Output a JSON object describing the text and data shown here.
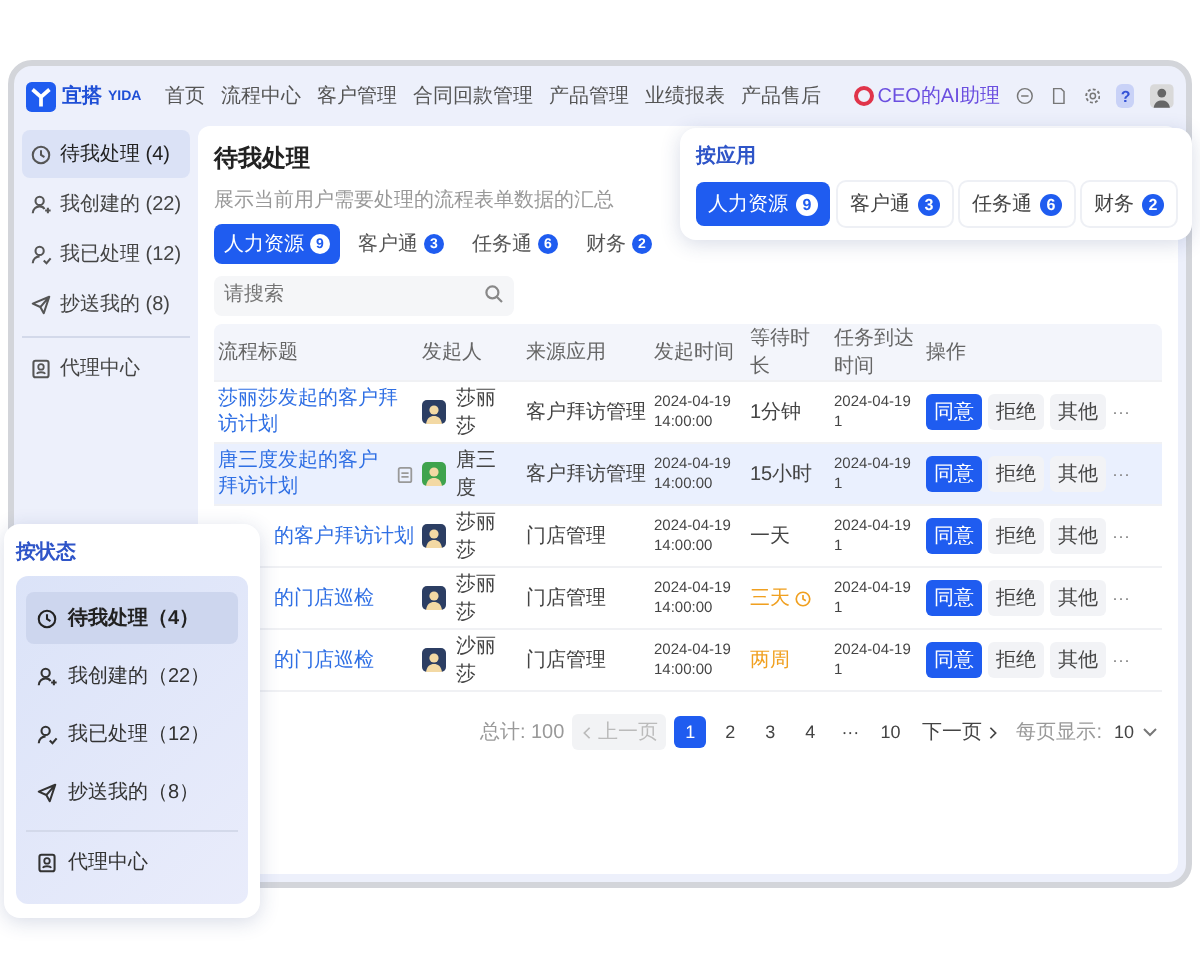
{
  "nav": {
    "logo": {
      "name": "宜搭",
      "latin": "YIDA"
    },
    "items": [
      {
        "label": "首页"
      },
      {
        "label": "流程中心"
      },
      {
        "label": "客户管理"
      },
      {
        "label": "合同回款管理"
      },
      {
        "label": "产品管理"
      },
      {
        "label": "业绩报表"
      },
      {
        "label": "产品售后"
      }
    ],
    "assistant": "CEO的AI助理",
    "help": "?"
  },
  "sidebar": {
    "items": [
      {
        "kind": "clock",
        "label": "待我处理 (4)",
        "selected": true,
        "divider_before": false
      },
      {
        "kind": "person-plus",
        "label": "我创建的 (22)",
        "selected": false,
        "divider_before": false
      },
      {
        "kind": "person-check",
        "label": "我已处理 (12)",
        "selected": false,
        "divider_before": false
      },
      {
        "kind": "send",
        "label": "抄送我的 (8)",
        "selected": false,
        "divider_before": false
      },
      {
        "kind": "agent",
        "label": "代理中心",
        "selected": false,
        "divider_before": true
      }
    ]
  },
  "page": {
    "title": "待我处理",
    "description": "展示当前用户需要处理的流程表单数据的汇总"
  },
  "app_tabs": [
    {
      "label": "人力资源",
      "count": "9",
      "selected": true
    },
    {
      "label": "客户通",
      "count": "3",
      "selected": false
    },
    {
      "label": "任务通",
      "count": "6",
      "selected": false
    },
    {
      "label": "财务",
      "count": "2",
      "selected": false
    }
  ],
  "search": {
    "placeholder": "请搜索"
  },
  "table": {
    "columns": [
      "流程标题",
      "发起人",
      "来源应用",
      "发起时间",
      "等待时长",
      "任务到达时间",
      "操作"
    ],
    "rows": [
      {
        "selected": false,
        "covered": false,
        "title": "莎丽莎发起的客户拜访计划",
        "attachment": false,
        "initiator": {
          "name": "莎丽莎",
          "color": "#2c3e63"
        },
        "app": "客户拜访管理",
        "started": "2024-04-19 14:00:00",
        "wait": {
          "text": "1分钟",
          "overdue": false,
          "clock": false
        },
        "arrival": "2024-04-19 1",
        "actions": [
          "同意",
          "拒绝",
          "其他"
        ],
        "more": "···"
      },
      {
        "selected": true,
        "covered": false,
        "title": "唐三度发起的客户拜访计划",
        "attachment": true,
        "initiator": {
          "name": "唐三度",
          "color": "#3fa34d"
        },
        "app": "客户拜访管理",
        "started": "2024-04-19 14:00:00",
        "wait": {
          "text": "15小时",
          "overdue": false,
          "clock": false
        },
        "arrival": "2024-04-19 1",
        "actions": [
          "同意",
          "拒绝",
          "其他"
        ],
        "more": "···"
      },
      {
        "selected": false,
        "covered": true,
        "title": "的客户拜访计划",
        "attachment": false,
        "initiator": {
          "name": "莎丽莎",
          "color": "#2c3e63"
        },
        "app": "门店管理",
        "started": "2024-04-19 14:00:00",
        "wait": {
          "text": "一天",
          "overdue": false,
          "clock": false
        },
        "arrival": "2024-04-19 1",
        "actions": [
          "同意",
          "拒绝",
          "其他"
        ],
        "more": "···"
      },
      {
        "selected": false,
        "covered": true,
        "title": "的门店巡检",
        "attachment": false,
        "initiator": {
          "name": "莎丽莎",
          "color": "#2c3e63"
        },
        "app": "门店管理",
        "started": "2024-04-19 14:00:00",
        "wait": {
          "text": "三天",
          "overdue": true,
          "clock": true
        },
        "arrival": "2024-04-19 1",
        "actions": [
          "同意",
          "拒绝",
          "其他"
        ],
        "more": "···"
      },
      {
        "selected": false,
        "covered": true,
        "title": "的门店巡检",
        "attachment": false,
        "initiator": {
          "name": "沙丽莎",
          "color": "#2c3e63"
        },
        "app": "门店管理",
        "started": "2024-04-19 14:00:00",
        "wait": {
          "text": "两周",
          "overdue": true,
          "clock": false
        },
        "arrival": "2024-04-19 1",
        "actions": [
          "同意",
          "拒绝",
          "其他"
        ],
        "more": "···"
      }
    ]
  },
  "pagination": {
    "total": "总计: 100",
    "prev": {
      "label": "上一页",
      "disabled": true
    },
    "pages": [
      {
        "label": "1",
        "selected": true
      },
      {
        "label": "2",
        "selected": false
      },
      {
        "label": "3",
        "selected": false
      },
      {
        "label": "4",
        "selected": false
      },
      {
        "label": "···",
        "selected": false
      },
      {
        "label": "10",
        "selected": false
      }
    ],
    "next": {
      "label": "下一页",
      "disabled": false
    },
    "page_size_label": "每页显示:",
    "page_size": "10"
  },
  "app_callout": {
    "title": "按应用",
    "tabs": [
      {
        "label": "人力资源",
        "count": "9",
        "selected": true
      },
      {
        "label": "客户通",
        "count": "3",
        "selected": false
      },
      {
        "label": "任务通",
        "count": "6",
        "selected": false
      },
      {
        "label": "财务",
        "count": "2",
        "selected": false
      }
    ]
  },
  "status_callout": {
    "title": "按状态",
    "items": [
      {
        "kind": "clock",
        "label": "待我处理（4）",
        "selected": true,
        "divider_before": false
      },
      {
        "kind": "person-plus",
        "label": "我创建的（22）",
        "selected": false,
        "divider_before": false
      },
      {
        "kind": "person-check",
        "label": "我已处理（12）",
        "selected": false,
        "divider_before": false
      },
      {
        "kind": "send",
        "label": "抄送我的（8）",
        "selected": false,
        "divider_before": false
      },
      {
        "kind": "agent",
        "label": "代理中心",
        "selected": false,
        "divider_before": true
      }
    ]
  }
}
